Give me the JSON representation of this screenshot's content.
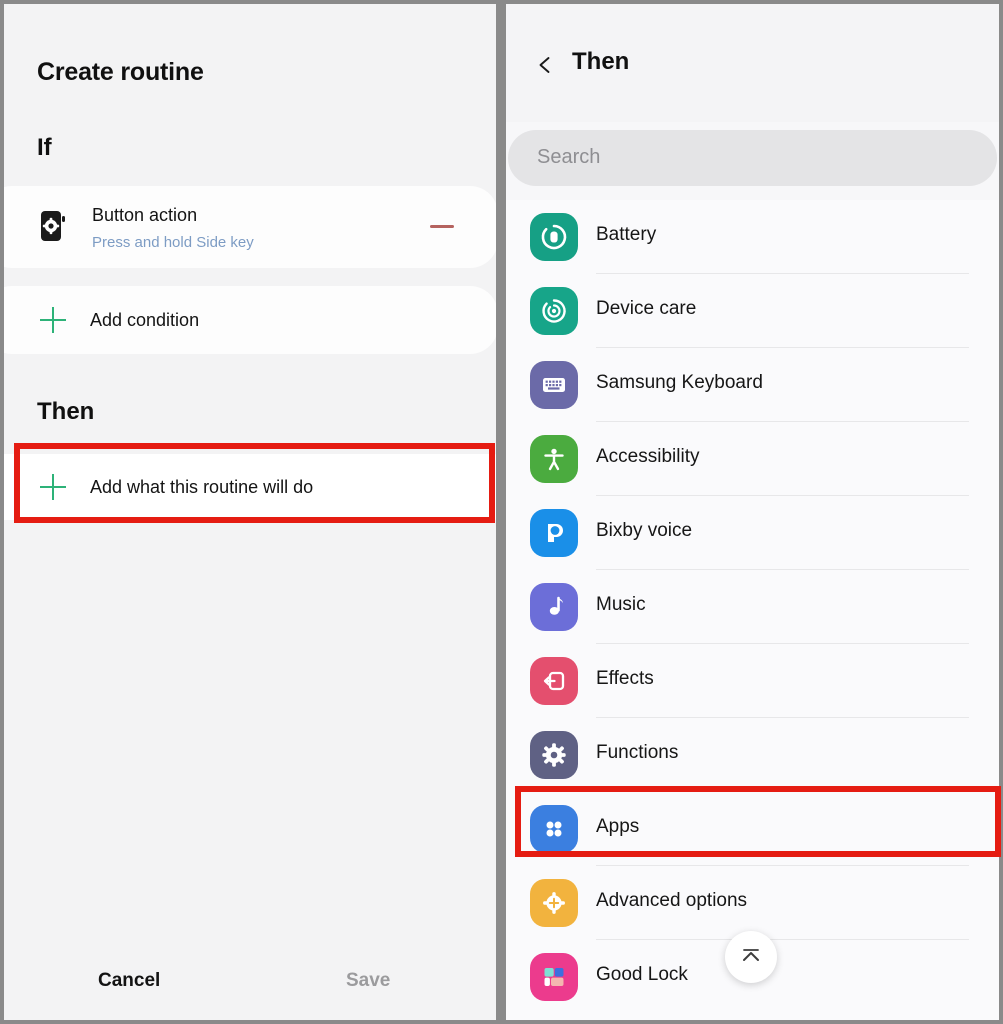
{
  "colors": {
    "highlight": "#e51c12",
    "accent_green": "#2db278",
    "subtitle_blue": "#7d9cc4",
    "minus_red": "#b5635f",
    "frame_gray": "#8a8a8a"
  },
  "left_panel": {
    "title": "Create routine",
    "if_section": {
      "heading": "If",
      "condition": {
        "icon": "phone-gear-icon",
        "title": "Button action",
        "subtitle": "Press and hold Side key",
        "remove_icon": "minus-icon"
      },
      "add_condition": {
        "icon": "plus-icon",
        "label": "Add condition"
      }
    },
    "then_section": {
      "heading": "Then",
      "add_action": {
        "icon": "plus-icon",
        "label": "Add what this routine will do",
        "highlighted": true
      }
    },
    "footer": {
      "cancel_label": "Cancel",
      "save_label": "Save"
    }
  },
  "right_panel": {
    "back_icon": "chevron-left-icon",
    "title": "Then",
    "search": {
      "icon": "search-icon",
      "placeholder": "Search",
      "value": ""
    },
    "options": [
      {
        "label": "Battery",
        "icon": "battery-icon",
        "color": "#16a085",
        "highlighted": false
      },
      {
        "label": "Device care",
        "icon": "device-care-icon",
        "color": "#17a589",
        "highlighted": false
      },
      {
        "label": "Samsung Keyboard",
        "icon": "keyboard-icon",
        "color": "#6b6aa8",
        "highlighted": false
      },
      {
        "label": "Accessibility",
        "icon": "accessibility-icon",
        "color": "#4bab3f",
        "highlighted": false
      },
      {
        "label": "Bixby voice",
        "icon": "bixby-icon",
        "color": "#1a8fe8",
        "highlighted": false
      },
      {
        "label": "Music",
        "icon": "music-note-icon",
        "color": "#6c6ed8",
        "highlighted": false
      },
      {
        "label": "Effects",
        "icon": "effects-icon",
        "color": "#e44f6e",
        "highlighted": false
      },
      {
        "label": "Functions",
        "icon": "gear-icon",
        "color": "#5f6184",
        "highlighted": false
      },
      {
        "label": "Apps",
        "icon": "apps-grid-icon",
        "color": "#3b7fe0",
        "highlighted": true
      },
      {
        "label": "Advanced options",
        "icon": "advanced-options-icon",
        "color": "#f2b košt",
        "highlighted": false
      },
      {
        "label": "Good Lock",
        "icon": "good-lock-icon",
        "color": "#ec3b8d",
        "highlighted": false
      }
    ],
    "scroll_top_button": {
      "icon": "scroll-to-top-icon"
    }
  }
}
